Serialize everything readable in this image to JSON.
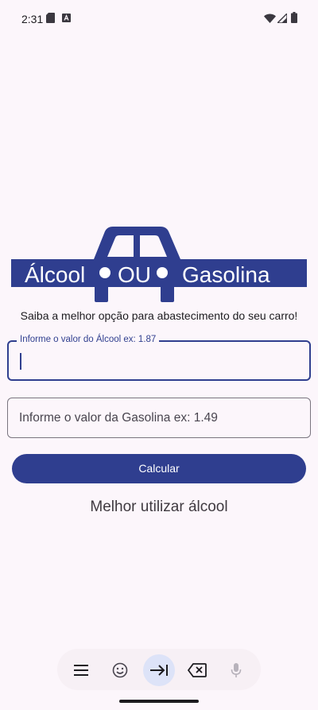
{
  "status_bar": {
    "time": "2:31",
    "icons": [
      "sim-card-icon",
      "keyboard-a-icon",
      "wifi-icon",
      "signal-icon",
      "battery-icon"
    ]
  },
  "logo": {
    "word_left": "Álcool",
    "word_middle": "OU",
    "word_right": "Gasolina",
    "color": "#2f3e8f"
  },
  "tagline": "Saiba a melhor opção para abastecimento do seu carro!",
  "fields": {
    "alcool": {
      "label": "Informe o valor do Álcool ex: 1.87",
      "value": ""
    },
    "gasolina": {
      "placeholder": "Informe o valor da Gasolina ex: 1.49",
      "value": ""
    }
  },
  "button": {
    "label": "Calcular",
    "color": "#2f3e8f"
  },
  "result": "Melhor utilizar álcool",
  "keyboard_toolbar": {
    "buttons": [
      "menu-icon",
      "emoji-icon",
      "tab-icon",
      "backspace-icon",
      "microphone-icon"
    ]
  }
}
